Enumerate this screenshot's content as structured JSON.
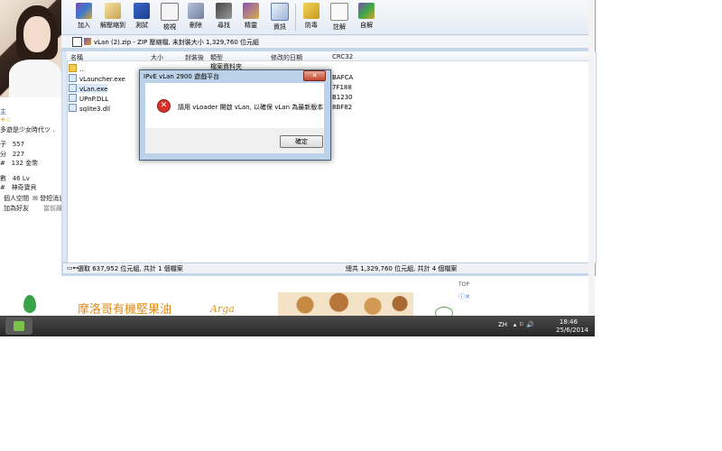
{
  "toolbar": {
    "buttons": [
      {
        "label": "加入",
        "icon": "add-archive-icon"
      },
      {
        "label": "解壓縮到",
        "icon": "extract-to-icon"
      },
      {
        "label": "測試",
        "icon": "test-icon"
      },
      {
        "label": "檢視",
        "icon": "view-icon"
      },
      {
        "label": "刪除",
        "icon": "delete-icon"
      },
      {
        "label": "尋找",
        "icon": "find-icon"
      },
      {
        "label": "精靈",
        "icon": "wizard-icon"
      },
      {
        "label": "資訊",
        "icon": "info-icon"
      },
      {
        "label": "防毒",
        "icon": "virus-scan-icon"
      },
      {
        "label": "註解",
        "icon": "comment-icon"
      },
      {
        "label": "自解",
        "icon": "sfx-icon"
      }
    ]
  },
  "path": {
    "text": "vLan (2).zip - ZIP 壓縮檔, 未封裝大小 1,329,760 位元組"
  },
  "columns": [
    "名稱",
    "大小",
    "封裝後",
    "類型",
    "修改的日期",
    "CRC32"
  ],
  "files": [
    {
      "name": "..",
      "type": "檔案資料夾",
      "crc": ""
    },
    {
      "name": "vLauncher.exe",
      "crc": "BAFCA"
    },
    {
      "name": "vLan.exe",
      "crc": "7F188"
    },
    {
      "name": "UPnP.DLL",
      "crc": "B1230"
    },
    {
      "name": "sqlite3.dll",
      "crc": "8BF82"
    }
  ],
  "status": {
    "left": "選取 637,952 位元組, 共計 1 個檔案",
    "right": "總共 1,329,760 位元組, 共計 4 個檔案"
  },
  "dialog": {
    "title": "IPvE vLan 2900 遊戲平台",
    "close": "✕",
    "message": "請用 vLoader 開啟 vLan, 以確保 vLan 為最新版本",
    "ok": "確定"
  },
  "profile": {
    "line1": "主",
    "line2": "多遊是少女時代ツ .",
    "stats": [
      {
        "label": "子",
        "value": "557"
      },
      {
        "label": "分",
        "value": "227"
      },
      {
        "label": "#",
        "value": "132 金幣"
      },
      {
        "label": "數",
        "value": "46 Lv"
      },
      {
        "label": "#",
        "value": "神奇寶貝"
      }
    ],
    "links": [
      "個人空間",
      "發短消息",
      "加為好友",
      "當前離線"
    ]
  },
  "ad": {
    "text": "摩洛哥有機堅果油",
    "brand": "Arga"
  },
  "page": {
    "top": "TOP"
  },
  "taskbar": {
    "tray": "ZH",
    "time": "18:46",
    "date": "25/6/2014"
  }
}
